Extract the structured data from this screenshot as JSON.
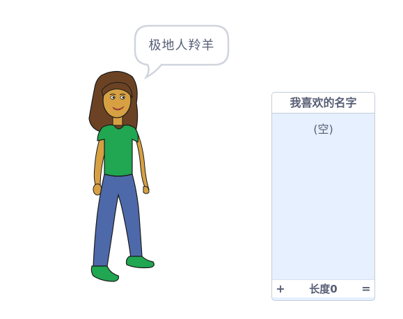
{
  "speech_bubble": {
    "text": "极地人羚羊"
  },
  "list_monitor": {
    "title": "我喜欢的名字",
    "empty_label": "(空)",
    "add_button": "+",
    "length_label": "长度0",
    "resize_handle": "="
  },
  "colors": {
    "text": "#575e75",
    "list_bg": "#e6f0ff",
    "border": "#c4ccd9",
    "shirt": "#21a651",
    "jeans": "#4e69aa",
    "skin": "#d6a043",
    "hair": "#6b4324"
  }
}
